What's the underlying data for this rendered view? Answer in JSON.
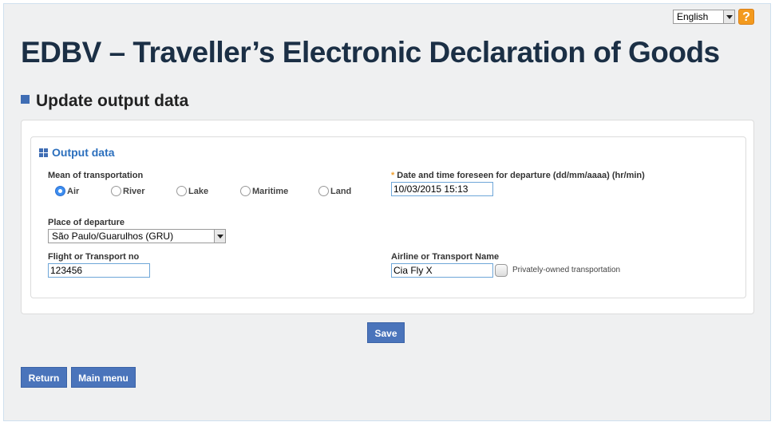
{
  "header": {
    "language": "English",
    "help_label": "?",
    "title": "EDBV – Traveller’s Electronic Declaration of Goods"
  },
  "section": {
    "title": "Update output data"
  },
  "form": {
    "group_title": "Output data",
    "transport": {
      "label": "Mean of transportation",
      "options": [
        "Air",
        "River",
        "Lake",
        "Maritime",
        "Land"
      ],
      "selected": "Air"
    },
    "departure_datetime": {
      "required_mark": "*",
      "label": "Date and time foreseen for departure (dd/mm/aaaa) (hr/min)",
      "value": "10/03/2015 15:13"
    },
    "place_of_departure": {
      "label": "Place of departure",
      "value": "São Paulo/Guarulhos (GRU)"
    },
    "flight_no": {
      "label": "Flight or Transport no",
      "value": "123456"
    },
    "airline": {
      "label": "Airline or Transport Name",
      "value": "Cia Fly X"
    },
    "private_transport": {
      "label": "Privately-owned transportation",
      "checked": false
    }
  },
  "buttons": {
    "save": "Save",
    "return": "Return",
    "main_menu": "Main menu"
  },
  "colors": {
    "accent": "#4a74bb",
    "title": "#1b2f45",
    "group_title": "#2b6fbd",
    "help": "#f39a1e"
  }
}
